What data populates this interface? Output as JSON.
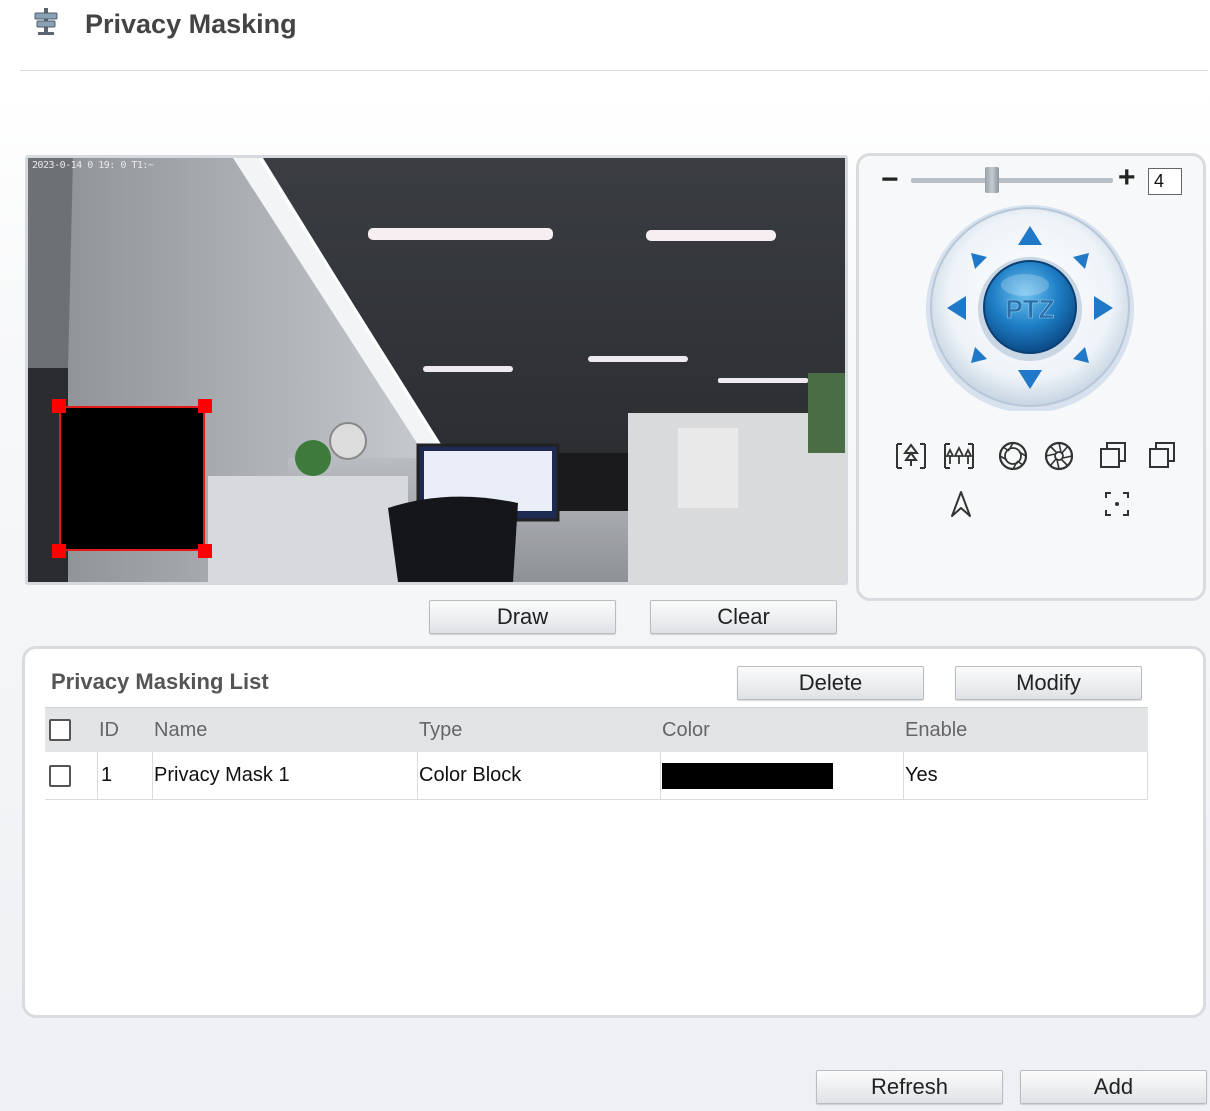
{
  "header": {
    "title": "Privacy Masking",
    "icon": "privacy-masking-icon"
  },
  "video": {
    "osd_text": "2023-0-14 0 19: 0 T1:~",
    "mask_color": "#000000",
    "mask_border_color": "#e41b1b"
  },
  "video_controls": {
    "draw_label": "Draw",
    "clear_label": "Clear"
  },
  "ptz": {
    "zoom_minus": "−",
    "zoom_plus": "+",
    "speed_value": "4",
    "speed_fraction": 0.4,
    "center_label": "PTZ",
    "tools": [
      "zoom-in-icon",
      "zoom-out-icon",
      "focus-near-icon",
      "focus-far-icon",
      "iris-open-icon",
      "iris-close-icon",
      "auto-focus-icon",
      "3d-positioning-icon"
    ]
  },
  "list": {
    "title": "Privacy Masking List",
    "delete_label": "Delete",
    "modify_label": "Modify",
    "columns": [
      "ID",
      "Name",
      "Type",
      "Color",
      "Enable"
    ],
    "rows": [
      {
        "id": "1",
        "name": "Privacy Mask 1",
        "type": "Color Block",
        "color": "#000000",
        "enable": "Yes"
      }
    ]
  },
  "footer": {
    "refresh_label": "Refresh",
    "add_label": "Add"
  },
  "colors": {
    "accent_blue": "#1f78c8",
    "mask_handle": "#ff0000"
  }
}
